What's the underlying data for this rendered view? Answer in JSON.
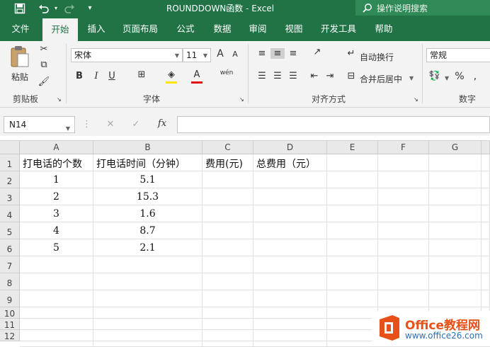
{
  "window": {
    "title": "ROUNDDOWN函数  -  Excel"
  },
  "quick_access": {
    "save_icon": "save-icon",
    "undo_icon": "undo-icon",
    "redo_icon": "redo-icon",
    "customize_icon": "chevron-down-icon"
  },
  "tell_me": {
    "label": "操作说明搜索"
  },
  "tabs": [
    "文件",
    "开始",
    "插入",
    "页面布局",
    "公式",
    "数据",
    "审阅",
    "视图",
    "开发工具",
    "帮助"
  ],
  "active_tab": "开始",
  "ribbon": {
    "clipboard": {
      "group": "剪贴板",
      "paste": "粘贴"
    },
    "font": {
      "group": "字体",
      "font_name": "宋体",
      "font_size": "11",
      "bold": "B",
      "italic": "I",
      "underline": "U",
      "grow": "A",
      "shrink": "A",
      "phonetic": "wén"
    },
    "alignment": {
      "group": "对齐方式",
      "wrap_text": "自动换行",
      "merge_center": "合并后居中"
    },
    "number": {
      "group": "数字",
      "format": "常规",
      "percent": "%"
    }
  },
  "formula_bar": {
    "name_box": "N14",
    "cancel": "✕",
    "enter": "✓",
    "fx": "fx",
    "content": ""
  },
  "sheet": {
    "columns": [
      "A",
      "B",
      "C",
      "D",
      "E",
      "F",
      "G"
    ],
    "rows": [
      "1",
      "2",
      "3",
      "4",
      "5",
      "6",
      "7",
      "8",
      "9",
      "10",
      "11",
      "12"
    ],
    "headers": [
      "打电话的个数",
      "打电话时间（分钟）",
      "费用(元)",
      "总费用（元）"
    ],
    "data": [
      [
        "1",
        "5.1"
      ],
      [
        "2",
        "15.3"
      ],
      [
        "3",
        "1.6"
      ],
      [
        "4",
        "8.7"
      ],
      [
        "5",
        "2.1"
      ]
    ]
  },
  "watermark": {
    "brand": "Office教程网",
    "url": "www.office26.com"
  },
  "colors": {
    "excel_green": "#217346",
    "ribbon_bg": "#f3f3f3",
    "header_bg": "#e9e9e9",
    "watermark_orange": "#e8501a",
    "watermark_blue": "#2b6fb7"
  }
}
